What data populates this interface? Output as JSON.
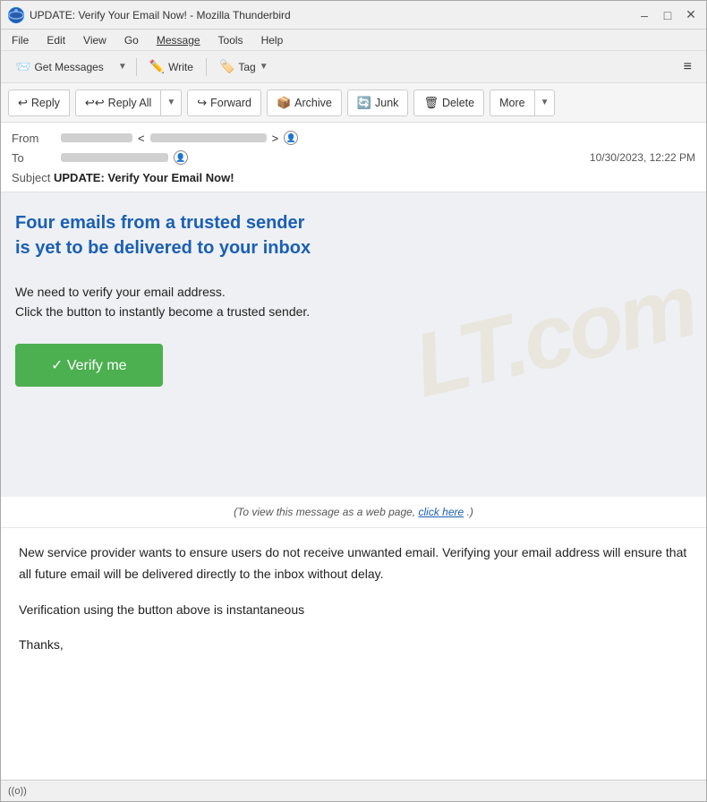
{
  "window": {
    "title": "UPDATE: Verify Your Email Now! - Mozilla Thunderbird",
    "icon": "T"
  },
  "titlebar": {
    "minimize": "–",
    "maximize": "□",
    "close": "✕"
  },
  "menubar": {
    "items": [
      "File",
      "Edit",
      "View",
      "Go",
      "Message",
      "Tools",
      "Help"
    ]
  },
  "toolbar": {
    "get_messages": "Get Messages",
    "write": "Write",
    "tag": "Tag",
    "hamburger": "≡"
  },
  "actionbar": {
    "reply": "Reply",
    "reply_all": "Reply All",
    "forward": "Forward",
    "archive": "Archive",
    "junk": "Junk",
    "delete": "Delete",
    "more": "More"
  },
  "email_header": {
    "from_label": "From",
    "to_label": "To",
    "subject_label": "Subject",
    "subject_value": "UPDATE: Verify Your Email Now!",
    "date": "10/30/2023, 12:22 PM"
  },
  "email_content": {
    "headline": "Four  emails from a trusted sender is yet to be delivered to your inbox",
    "body_text": "We need to verify your email address.\nClick the button to instantly become a trusted sender.",
    "verify_btn": "✓  Verify me",
    "web_page_note_prefix": "(To view this message as a web page,",
    "web_page_note_link": "click here",
    "web_page_note_suffix": ".)",
    "paragraph1": "New service provider wants to ensure users do not receive unwanted email. Verifying your email address will ensure that all future email  will be delivered directly to the inbox without delay.",
    "paragraph2": "Verification using the button above is instantaneous",
    "paragraph3": "Thanks,"
  },
  "statusbar": {
    "wifi_label": "((o))"
  },
  "watermark_text": "LT.com"
}
